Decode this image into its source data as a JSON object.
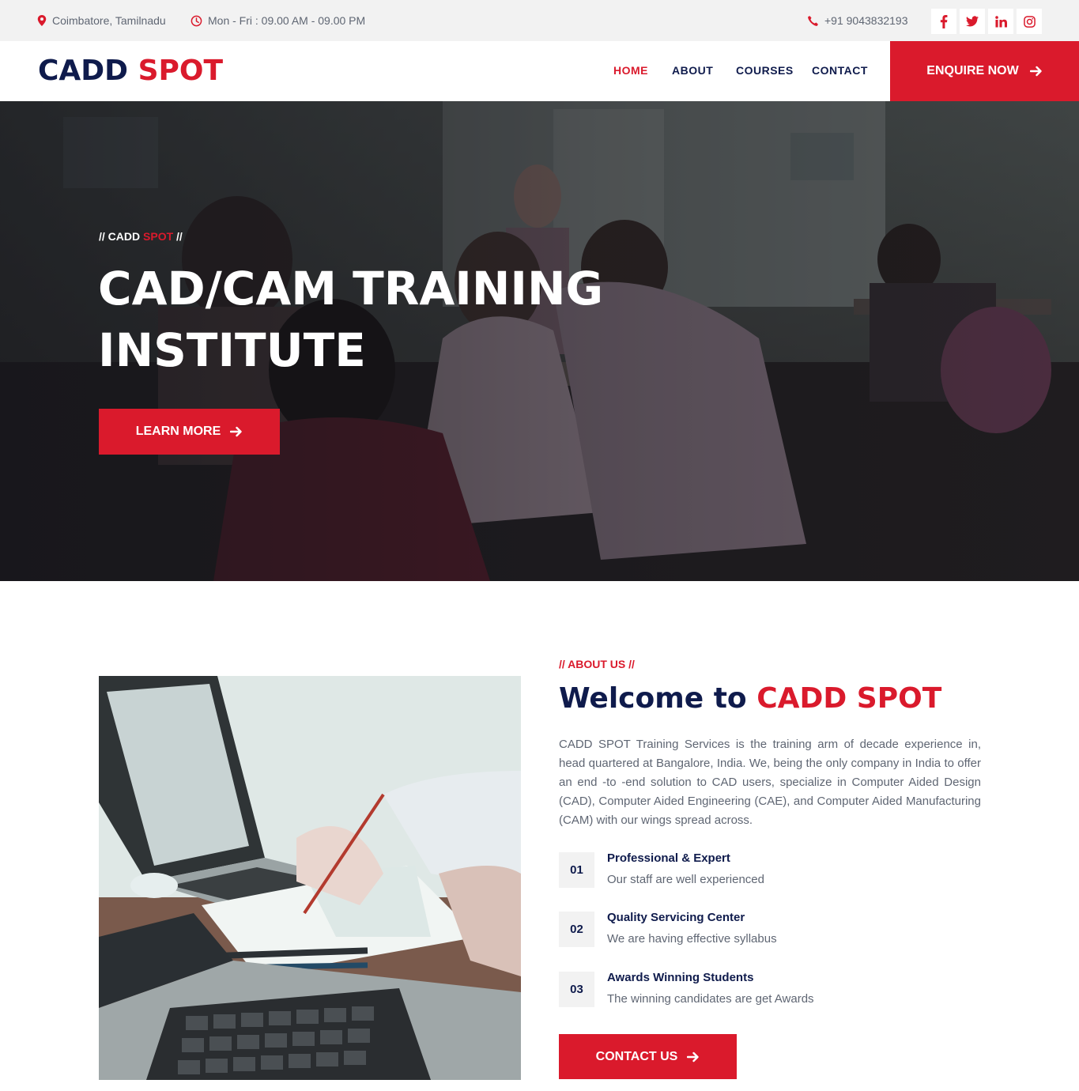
{
  "topbar": {
    "location": "Coimbatore, Tamilnadu",
    "hours": "Mon - Fri : 09.00 AM - 09.00 PM",
    "phone": "+91 9043832193",
    "socials": [
      "facebook-icon",
      "twitter-icon",
      "linkedin-icon",
      "instagram-icon"
    ]
  },
  "nav": {
    "logo_part1": "CADD",
    "logo_part2": "SPOT",
    "items": [
      "HOME",
      "ABOUT",
      "COURSES",
      "CONTACT"
    ],
    "active": "HOME",
    "cta": "ENQUIRE NOW"
  },
  "hero": {
    "kicker_prefix": "// CADD",
    "kicker_highlight": "SPOT",
    "kicker_suffix": "//",
    "title_line1": "CAD/CAM TRAINING",
    "title_line2": "INSTITUTE",
    "button": "LEARN MORE"
  },
  "about": {
    "kicker": "// ABOUT US //",
    "title_part1": "Welcome to",
    "title_part2": "CADD SPOT",
    "text": "CADD SPOT Training Services is the training arm of decade experience in, head quartered at Bangalore, India. We, being the only company in India to offer an end -to -end solution to CAD users, specialize in Computer Aided Design (CAD), Computer Aided Engineering (CAE), and Computer Aided Manufacturing (CAM) with our wings spread across.",
    "features": [
      {
        "num": "01",
        "title": "Professional & Expert",
        "desc": "Our staff are well experienced"
      },
      {
        "num": "02",
        "title": "Quality Servicing Center",
        "desc": "We are having effective syllabus"
      },
      {
        "num": "03",
        "title": "Awards Winning Students",
        "desc": "The winning candidates are get Awards"
      }
    ],
    "button": "CONTACT US"
  },
  "colors": {
    "accent": "#da1a2c",
    "navy": "#0f1b4c",
    "topbar_bg": "#f2f2f2",
    "body_text": "#5f6673"
  }
}
